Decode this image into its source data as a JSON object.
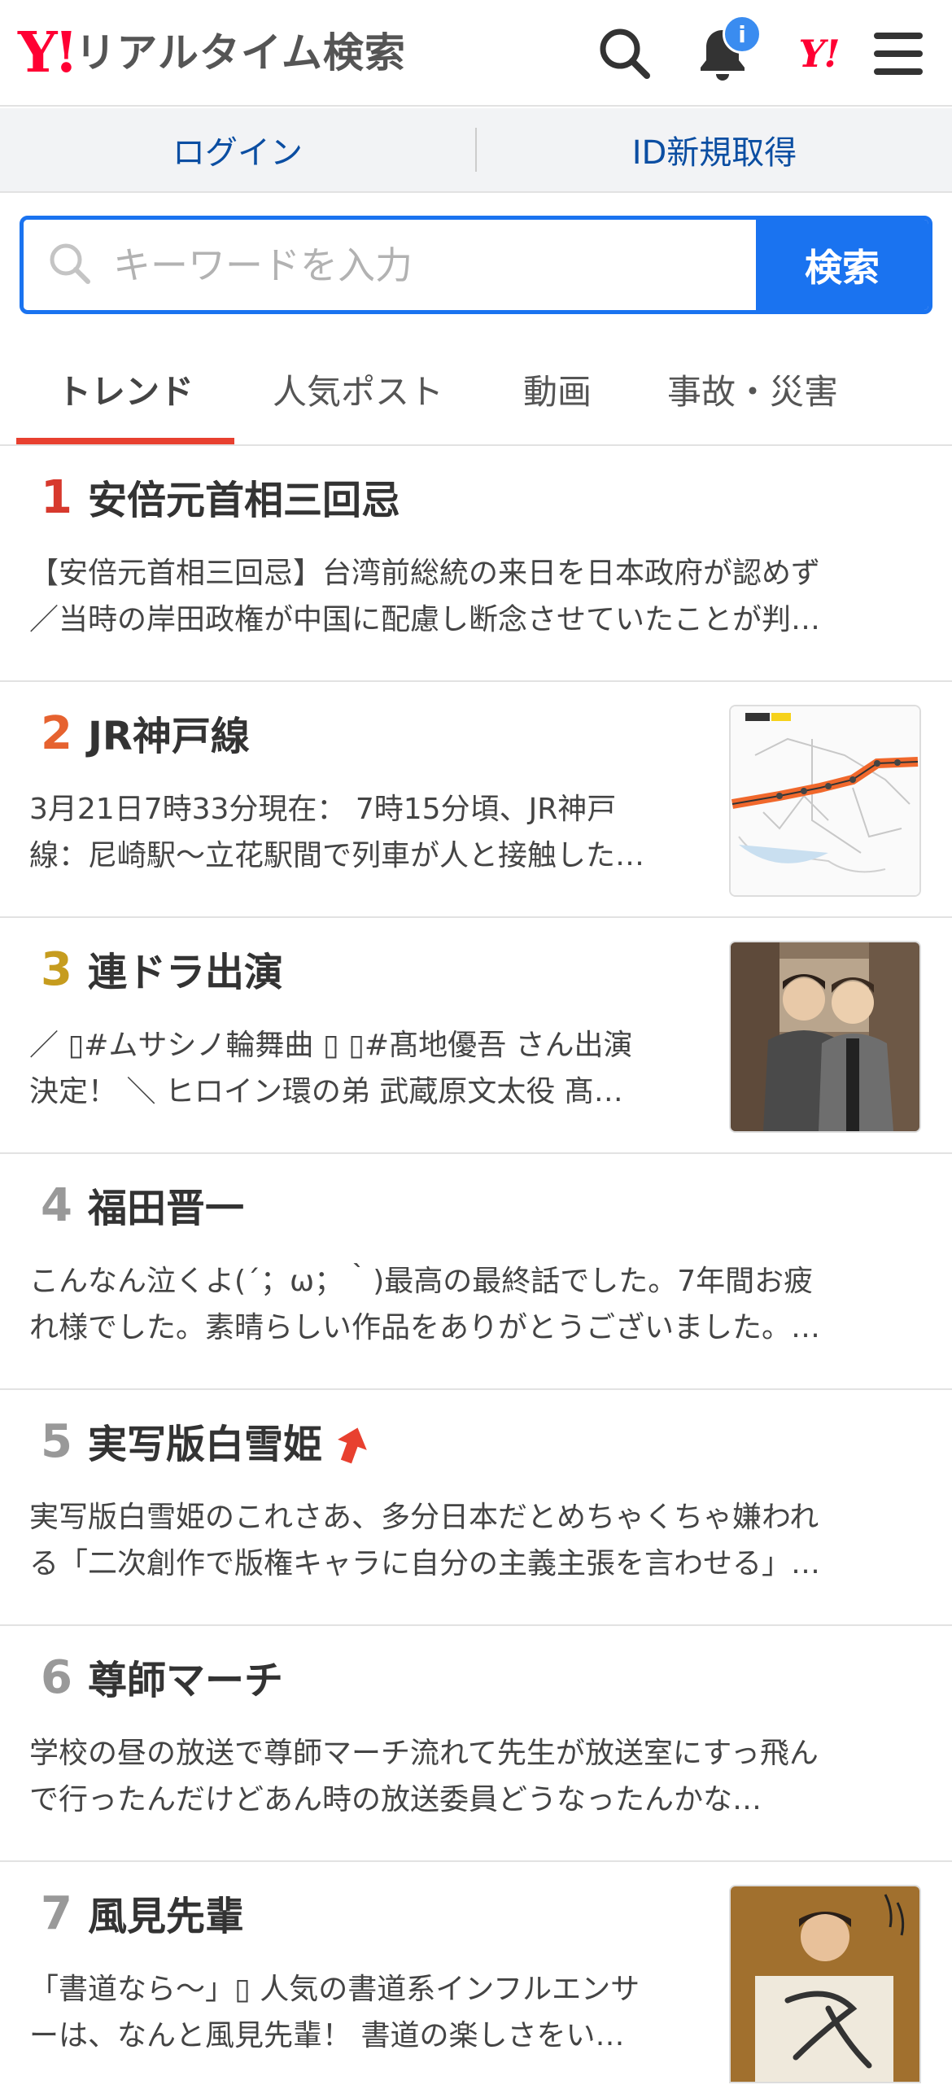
{
  "header": {
    "logo_mark": "Y!",
    "logo_text": "リアルタイム検索",
    "notification_badge": "i",
    "yj_mark": "Y!"
  },
  "auth": {
    "login": "ログイン",
    "register": "ID新規取得"
  },
  "search": {
    "placeholder": "キーワードを入力",
    "button": "検索"
  },
  "tabs": [
    {
      "label": "トレンド",
      "active": true
    },
    {
      "label": "人気ポスト",
      "active": false
    },
    {
      "label": "動画",
      "active": false
    },
    {
      "label": "事故・災害",
      "active": false
    }
  ],
  "trends": [
    {
      "rank": "1",
      "title": "安倍元首相三回忌",
      "desc": [
        "【安倍元首相三回忌】台湾前総統の来日を日本政府が認めず",
        "／当時の岸田政権が中国に配慮し断念させていたことが判…"
      ],
      "thumbnail": ""
    },
    {
      "rank": "2",
      "title": "JR神戸線",
      "desc": [
        "3月21日7時33分現在： 7時15分頃、JR神戸",
        "線：尼崎駅〜立花駅間で列車が人と接触した…"
      ],
      "thumbnail": "railway-route-map"
    },
    {
      "rank": "3",
      "title": "連ドラ出演",
      "desc": [
        "／ ▯#ムサシノ輪舞曲 ▯ ▯#髙地優吾 さん出演",
        "決定！ ＼ ヒロイン環の弟 武蔵原文太役 髙…"
      ],
      "thumbnail": "two-men-photo"
    },
    {
      "rank": "4",
      "title": "福田晋一",
      "desc": [
        "こんなん泣くよ(´；ω；｀)最高の最終話でした。7年間お疲",
        "れ様でした。素晴らしい作品をありがとうございました。…"
      ],
      "thumbnail": ""
    },
    {
      "rank": "5",
      "title": "実写版白雪姫",
      "rising": true,
      "desc": [
        "実写版白雪姫のこれさあ、多分日本だとめちゃくちゃ嫌われ",
        "る「二次創作で版権キャラに自分の主義主張を言わせる」…"
      ],
      "thumbnail": ""
    },
    {
      "rank": "6",
      "title": "尊師マーチ",
      "desc": [
        "学校の昼の放送で尊師マーチ流れて先生が放送室にすっ飛ん",
        "で行ったんだけどあん時の放送委員どうなったんかな…"
      ],
      "thumbnail": ""
    },
    {
      "rank": "7",
      "title": "風見先輩",
      "desc": [
        "「書道なら〜」▯ 人気の書道系インフルエンサ",
        "ーは、なんと風見先輩！ 書道の楽しさをい…"
      ],
      "thumbnail": "calligraphy-person-photo"
    }
  ],
  "colors": {
    "brand_red": "#ff0033",
    "accent_blue": "#1a73f0",
    "tab_indicator": "#e8402f",
    "rank1": "#d7392d",
    "rank2": "#e6622f",
    "rank3": "#c69c1e"
  }
}
